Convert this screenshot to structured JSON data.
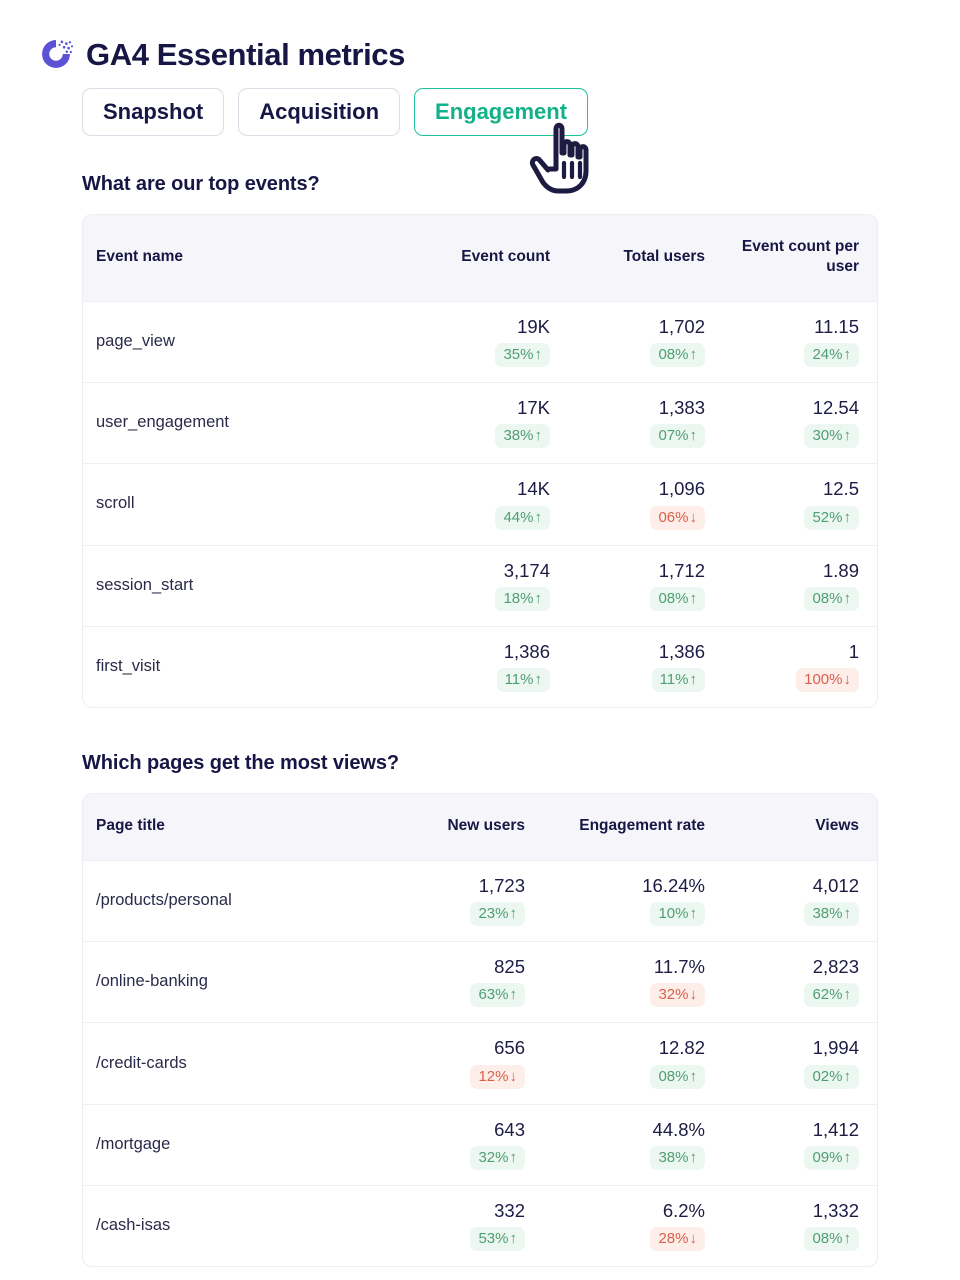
{
  "header": {
    "title": "GA4 Essential metrics",
    "logo_icon": "circular-dots-logo-icon"
  },
  "tabs": [
    {
      "label": "Snapshot",
      "active": false
    },
    {
      "label": "Acquisition",
      "active": false
    },
    {
      "label": "Engagement",
      "active": true
    }
  ],
  "cursor": {
    "icon": "pointing-hand-cursor-icon"
  },
  "colors": {
    "accent_active": "#12b189",
    "accent_border": "#1fc39a",
    "text_primary": "#171645",
    "up": "#4f9e73",
    "up_bg": "#edf7f1",
    "down": "#d9604b",
    "down_bg": "#fdeeea",
    "brand_logo": "#5b53d4",
    "header_bg": "#f6f6fa"
  },
  "sections": [
    {
      "id": "events",
      "heading": "What are our top events?",
      "columns": [
        "Event name",
        "Event count",
        "Total users",
        "Event count per user"
      ],
      "rows": [
        {
          "name": "page_view",
          "metrics": [
            {
              "value": "19K",
              "delta": "35%",
              "dir": "up",
              "arrow": "↑"
            },
            {
              "value": "1,702",
              "delta": "08%",
              "dir": "up",
              "arrow": "↑"
            },
            {
              "value": "11.15",
              "delta": "24%",
              "dir": "up",
              "arrow": "↑"
            }
          ]
        },
        {
          "name": "user_engagement",
          "metrics": [
            {
              "value": "17K",
              "delta": "38%",
              "dir": "up",
              "arrow": "↑"
            },
            {
              "value": "1,383",
              "delta": "07%",
              "dir": "up",
              "arrow": "↑"
            },
            {
              "value": "12.54",
              "delta": "30%",
              "dir": "up",
              "arrow": "↑"
            }
          ]
        },
        {
          "name": "scroll",
          "metrics": [
            {
              "value": "14K",
              "delta": "44%",
              "dir": "up",
              "arrow": "↑"
            },
            {
              "value": "1,096",
              "delta": "06%",
              "dir": "down",
              "arrow": "↓"
            },
            {
              "value": "12.5",
              "delta": "52%",
              "dir": "up",
              "arrow": "↑"
            }
          ]
        },
        {
          "name": "session_start",
          "metrics": [
            {
              "value": "3,174",
              "delta": "18%",
              "dir": "up",
              "arrow": "↑"
            },
            {
              "value": "1,712",
              "delta": "08%",
              "dir": "up",
              "arrow": "↑"
            },
            {
              "value": "1.89",
              "delta": "08%",
              "dir": "up",
              "arrow": "↑"
            }
          ]
        },
        {
          "name": "first_visit",
          "metrics": [
            {
              "value": "1,386",
              "delta": "11%",
              "dir": "up",
              "arrow": "↑"
            },
            {
              "value": "1,386",
              "delta": "11%",
              "dir": "up",
              "arrow": "↑"
            },
            {
              "value": "1",
              "delta": "100%",
              "dir": "down",
              "arrow": "↓"
            }
          ]
        }
      ]
    },
    {
      "id": "pages",
      "heading": "Which pages get the most views?",
      "columns": [
        "Page title",
        "New users",
        "Engagement rate",
        "Views"
      ],
      "rows": [
        {
          "name": "/products/personal",
          "metrics": [
            {
              "value": "1,723",
              "delta": "23%",
              "dir": "up",
              "arrow": "↑"
            },
            {
              "value": "16.24%",
              "delta": "10%",
              "dir": "up",
              "arrow": "↑"
            },
            {
              "value": "4,012",
              "delta": "38%",
              "dir": "up",
              "arrow": "↑"
            }
          ]
        },
        {
          "name": "/online-banking",
          "metrics": [
            {
              "value": "825",
              "delta": "63%",
              "dir": "up",
              "arrow": "↑"
            },
            {
              "value": "11.7%",
              "delta": "32%",
              "dir": "down",
              "arrow": "↓"
            },
            {
              "value": "2,823",
              "delta": "62%",
              "dir": "up",
              "arrow": "↑"
            }
          ]
        },
        {
          "name": "/credit-cards",
          "metrics": [
            {
              "value": "656",
              "delta": "12%",
              "dir": "down",
              "arrow": "↓"
            },
            {
              "value": "12.82",
              "delta": "08%",
              "dir": "up",
              "arrow": "↑"
            },
            {
              "value": "1,994",
              "delta": "02%",
              "dir": "up",
              "arrow": "↑"
            }
          ]
        },
        {
          "name": "/mortgage",
          "metrics": [
            {
              "value": "643",
              "delta": "32%",
              "dir": "up",
              "arrow": "↑"
            },
            {
              "value": "44.8%",
              "delta": "38%",
              "dir": "up",
              "arrow": "↑"
            },
            {
              "value": "1,412",
              "delta": "09%",
              "dir": "up",
              "arrow": "↑"
            }
          ]
        },
        {
          "name": "/cash-isas",
          "metrics": [
            {
              "value": "332",
              "delta": "53%",
              "dir": "up",
              "arrow": "↑"
            },
            {
              "value": "6.2%",
              "delta": "28%",
              "dir": "down",
              "arrow": "↓"
            },
            {
              "value": "1,332",
              "delta": "08%",
              "dir": "up",
              "arrow": "↑"
            }
          ]
        }
      ]
    }
  ]
}
